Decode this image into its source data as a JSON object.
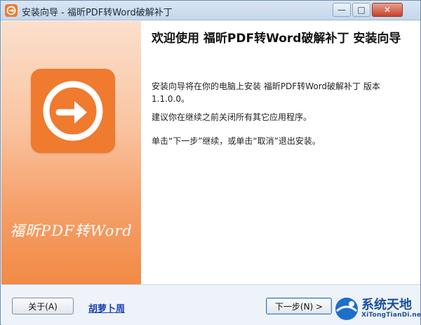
{
  "window": {
    "title": "安装向导 - 福昕PDF转Word破解补丁",
    "controls": {
      "minimize": "—",
      "maximize": "□",
      "close": "✕"
    }
  },
  "side_panel": {
    "brand_text": "福昕PDF转Word",
    "logo_icon": "circular-arrow-icon",
    "accent_color": "#f07a2e"
  },
  "main": {
    "heading": "欢迎使用 福昕PDF转Word破解补丁 安装向导",
    "paragraphs": [
      "安装向导将在你的电脑上安装 福昕PDF转Word破解补丁 版本 1.1.0.0。",
      "建议你在继续之前关闭所有其它应用程序。",
      "单击“下一步”继续，或单击“取消”退出安装。"
    ]
  },
  "footer": {
    "about_button": "关于(A)",
    "link_text": "胡萝卜周",
    "next_button": "下一步(N) >"
  },
  "watermark": {
    "main": "系统天地",
    "sub": "XiTongTianDi.net"
  }
}
